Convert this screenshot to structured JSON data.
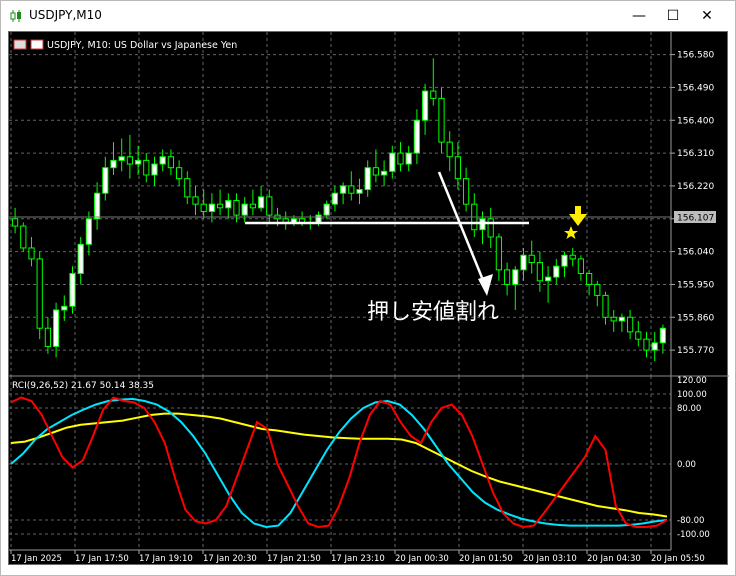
{
  "window": {
    "title": "USDJPY,M10",
    "app_icon": "candlestick-icon",
    "minimize": "—",
    "maximize": "☐",
    "close": "✕"
  },
  "chart_header": {
    "label": "USDJPY, M10:  US Dollar vs Japanese Yen"
  },
  "price_axis": {
    "labels": [
      "156.580",
      "156.490",
      "156.400",
      "156.310",
      "156.220",
      "156.130",
      "156.040",
      "155.950",
      "155.860",
      "155.770"
    ],
    "current_price": "156.107"
  },
  "indicator": {
    "label": "RCI(9,26,52) 21.67 50.14 38.35",
    "axis_labels": [
      "120.00",
      "100.00",
      "80.00",
      "0.00",
      "-80.00",
      "-100.00"
    ]
  },
  "time_axis": {
    "labels": [
      "17 Jan 2025",
      "17 Jan 17:50",
      "17 Jan 19:10",
      "17 Jan 20:30",
      "17 Jan 21:50",
      "17 Jan 23:10",
      "20 Jan 00:30",
      "20 Jan 01:50",
      "20 Jan 03:10",
      "20 Jan 04:30",
      "20 Jan 05:50"
    ]
  },
  "annotation": {
    "text": "押し安値割れ"
  },
  "colors": {
    "bull": "#ffffff",
    "bear": "#00ff00",
    "wick": "#00ff00",
    "grid": "#646464",
    "rci_short": "#ff0000",
    "rci_mid": "#00e5ff",
    "rci_long": "#ffff00",
    "arrow": "#ffee00"
  },
  "chart_data": {
    "type": "candlestick",
    "ylim": [
      155.71,
      156.62
    ],
    "indicator_ylim": [
      -120,
      120
    ],
    "candles": [
      [
        156.13,
        156.16,
        156.09,
        156.11
      ],
      [
        156.11,
        156.12,
        156.04,
        156.05
      ],
      [
        156.05,
        156.08,
        156.0,
        156.02
      ],
      [
        156.02,
        156.04,
        155.8,
        155.83
      ],
      [
        155.83,
        155.86,
        155.76,
        155.78
      ],
      [
        155.78,
        155.9,
        155.75,
        155.88
      ],
      [
        155.88,
        155.92,
        155.85,
        155.89
      ],
      [
        155.89,
        156.0,
        155.87,
        155.98
      ],
      [
        155.98,
        156.08,
        155.95,
        156.06
      ],
      [
        156.06,
        156.15,
        156.03,
        156.13
      ],
      [
        156.13,
        156.23,
        156.1,
        156.2
      ],
      [
        156.2,
        156.3,
        156.18,
        156.27
      ],
      [
        156.27,
        156.34,
        156.25,
        156.29
      ],
      [
        156.29,
        156.35,
        156.26,
        156.3
      ],
      [
        156.3,
        156.36,
        156.24,
        156.28
      ],
      [
        156.28,
        156.33,
        156.25,
        156.29
      ],
      [
        156.29,
        156.31,
        156.23,
        156.25
      ],
      [
        156.25,
        156.3,
        156.22,
        156.28
      ],
      [
        156.28,
        156.32,
        156.26,
        156.3
      ],
      [
        156.3,
        156.32,
        156.25,
        156.27
      ],
      [
        156.27,
        156.29,
        156.22,
        156.24
      ],
      [
        156.24,
        156.26,
        156.17,
        156.19
      ],
      [
        156.19,
        156.22,
        156.14,
        156.17
      ],
      [
        156.17,
        156.21,
        156.13,
        156.15
      ],
      [
        156.15,
        156.2,
        156.12,
        156.17
      ],
      [
        156.17,
        156.21,
        156.14,
        156.16
      ],
      [
        156.16,
        156.2,
        156.13,
        156.18
      ],
      [
        156.18,
        156.2,
        156.12,
        156.14
      ],
      [
        156.14,
        156.19,
        156.12,
        156.17
      ],
      [
        156.17,
        156.21,
        156.14,
        156.16
      ],
      [
        156.16,
        156.22,
        156.15,
        156.19
      ],
      [
        156.19,
        156.21,
        156.12,
        156.14
      ],
      [
        156.14,
        156.16,
        156.11,
        156.13
      ],
      [
        156.13,
        156.15,
        156.1,
        156.12
      ],
      [
        156.12,
        156.14,
        156.11,
        156.13
      ],
      [
        156.13,
        156.15,
        156.11,
        156.12
      ],
      [
        156.12,
        156.14,
        156.1,
        156.12
      ],
      [
        156.12,
        156.15,
        156.11,
        156.14
      ],
      [
        156.14,
        156.18,
        156.13,
        156.17
      ],
      [
        156.17,
        156.22,
        156.15,
        156.2
      ],
      [
        156.2,
        156.23,
        156.17,
        156.22
      ],
      [
        156.22,
        156.26,
        156.18,
        156.2
      ],
      [
        156.2,
        156.24,
        156.17,
        156.21
      ],
      [
        156.21,
        156.29,
        156.19,
        156.27
      ],
      [
        156.27,
        156.32,
        156.23,
        156.25
      ],
      [
        156.25,
        156.29,
        156.22,
        156.26
      ],
      [
        156.26,
        156.33,
        156.24,
        156.31
      ],
      [
        156.31,
        156.34,
        156.26,
        156.28
      ],
      [
        156.28,
        156.33,
        156.26,
        156.31
      ],
      [
        156.31,
        156.43,
        156.28,
        156.4
      ],
      [
        156.4,
        156.5,
        156.36,
        156.48
      ],
      [
        156.48,
        156.57,
        156.44,
        156.46
      ],
      [
        156.46,
        156.49,
        156.31,
        156.34
      ],
      [
        156.34,
        156.37,
        156.26,
        156.3
      ],
      [
        156.3,
        156.34,
        156.21,
        156.24
      ],
      [
        156.24,
        156.27,
        156.15,
        156.17
      ],
      [
        156.17,
        156.2,
        156.08,
        156.1
      ],
      [
        156.1,
        156.15,
        156.06,
        156.13
      ],
      [
        156.13,
        156.16,
        156.05,
        156.08
      ],
      [
        156.08,
        156.09,
        155.96,
        155.99
      ],
      [
        155.99,
        156.01,
        155.92,
        155.95
      ],
      [
        155.95,
        156.0,
        155.88,
        155.99
      ],
      [
        155.99,
        156.05,
        155.96,
        156.03
      ],
      [
        156.03,
        156.07,
        155.98,
        156.01
      ],
      [
        156.01,
        156.04,
        155.93,
        155.96
      ],
      [
        155.96,
        156.0,
        155.9,
        155.97
      ],
      [
        155.97,
        156.02,
        155.95,
        156.0
      ],
      [
        156.0,
        156.04,
        155.97,
        156.03
      ],
      [
        156.03,
        156.05,
        156.0,
        156.02
      ],
      [
        156.02,
        156.03,
        155.96,
        155.98
      ],
      [
        155.98,
        155.99,
        155.92,
        155.95
      ],
      [
        155.95,
        155.96,
        155.89,
        155.92
      ],
      [
        155.92,
        155.93,
        155.84,
        155.86
      ],
      [
        155.86,
        155.88,
        155.82,
        155.85
      ],
      [
        155.85,
        155.87,
        155.82,
        155.86
      ],
      [
        155.86,
        155.88,
        155.8,
        155.82
      ],
      [
        155.82,
        155.85,
        155.78,
        155.8
      ],
      [
        155.8,
        155.82,
        155.75,
        155.77
      ],
      [
        155.77,
        155.82,
        155.74,
        155.79
      ],
      [
        155.79,
        155.84,
        155.76,
        155.83
      ]
    ],
    "rci_short": [
      88,
      95,
      90,
      70,
      40,
      10,
      -5,
      5,
      40,
      78,
      95,
      90,
      88,
      80,
      60,
      30,
      -20,
      -65,
      -82,
      -85,
      -80,
      -60,
      -20,
      20,
      60,
      50,
      0,
      -30,
      -60,
      -85,
      -90,
      -88,
      -60,
      -20,
      30,
      70,
      90,
      85,
      60,
      40,
      30,
      60,
      80,
      85,
      70,
      40,
      0,
      -40,
      -70,
      -85,
      -90,
      -88,
      -70,
      -50,
      -30,
      -10,
      10,
      40,
      20,
      -60,
      -85,
      -90,
      -90,
      -88,
      -80
    ],
    "rci_mid": [
      0,
      15,
      35,
      50,
      60,
      70,
      78,
      85,
      90,
      92,
      93,
      90,
      85,
      75,
      60,
      40,
      15,
      -15,
      -45,
      -70,
      -85,
      -90,
      -88,
      -70,
      -40,
      -10,
      20,
      45,
      65,
      80,
      88,
      90,
      85,
      70,
      50,
      25,
      0,
      -20,
      -40,
      -55,
      -65,
      -72,
      -78,
      -82,
      -85,
      -87,
      -88,
      -88,
      -88,
      -88,
      -88,
      -87,
      -85,
      -82,
      -80
    ],
    "rci_long": [
      30,
      32,
      38,
      45,
      52,
      56,
      58,
      60,
      62,
      66,
      70,
      72,
      72,
      70,
      68,
      65,
      60,
      55,
      50,
      48,
      45,
      42,
      40,
      38,
      37,
      36,
      36,
      36,
      35,
      30,
      20,
      10,
      0,
      -10,
      -18,
      -25,
      -30,
      -35,
      -40,
      -45,
      -50,
      -55,
      -60,
      -63,
      -66,
      -70,
      -72,
      -75
    ]
  }
}
